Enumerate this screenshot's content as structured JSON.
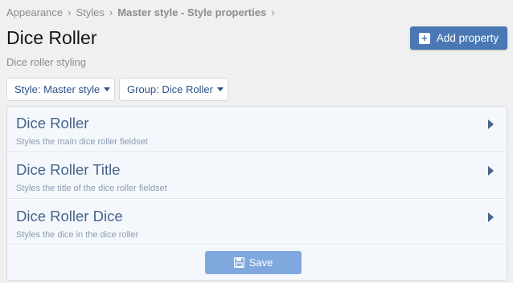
{
  "breadcrumb": {
    "items": [
      "Appearance",
      "Styles",
      "Master style - Style properties"
    ]
  },
  "page": {
    "title": "Dice Roller",
    "description": "Dice roller styling"
  },
  "actions": {
    "add_label": "Add property"
  },
  "filters": {
    "style_label": "Style: Master style",
    "group_label": "Group: Dice Roller"
  },
  "properties": [
    {
      "title": "Dice Roller",
      "description": "Styles the main dice roller fieldset"
    },
    {
      "title": "Dice Roller Title",
      "description": "Styles the title of the dice roller fieldset"
    },
    {
      "title": "Dice Roller Dice",
      "description": "Styles the dice in the dice roller"
    }
  ],
  "footer": {
    "save_label": "Save"
  },
  "icons": {
    "add": "plus-square-icon",
    "save": "floppy-disk-icon",
    "row_arrow": "caret-right-icon",
    "dropdown": "caret-down-icon"
  },
  "colors": {
    "primary_button": "#4a78b4",
    "save_button": "#7fa9de",
    "row_background": "#f4f8fc",
    "link_text": "#2b5287"
  }
}
